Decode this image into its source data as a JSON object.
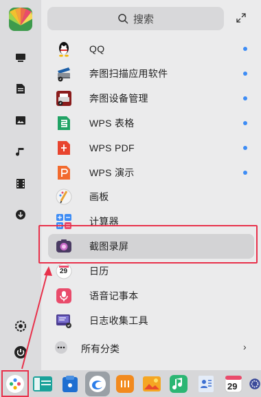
{
  "search": {
    "placeholder": "搜索"
  },
  "apps": [
    {
      "name": "QQ",
      "new": true,
      "icon": "qq-icon"
    },
    {
      "name": "奔图扫描应用软件",
      "new": true,
      "icon": "scanner-icon"
    },
    {
      "name": "奔图设备管理",
      "new": true,
      "icon": "printer-icon"
    },
    {
      "name": "WPS 表格",
      "new": true,
      "icon": "wps-spreadsheet-icon"
    },
    {
      "name": "WPS PDF",
      "new": true,
      "icon": "wps-pdf-icon"
    },
    {
      "name": "WPS 演示",
      "new": true,
      "icon": "wps-presentation-icon"
    },
    {
      "name": "画板",
      "new": false,
      "icon": "paint-icon"
    },
    {
      "name": "计算器",
      "new": false,
      "icon": "calculator-icon"
    },
    {
      "name": "截图录屏",
      "new": false,
      "icon": "screenshot-icon",
      "selected": true
    },
    {
      "name": "日历",
      "new": false,
      "icon": "calendar-icon"
    },
    {
      "name": "语音记事本",
      "new": false,
      "icon": "voice-note-icon"
    },
    {
      "name": "日志收集工具",
      "new": false,
      "icon": "log-collector-icon"
    }
  ],
  "all_categories": {
    "label": "所有分类"
  },
  "calendar_day": "29",
  "dock_calendar": {
    "day": "29"
  },
  "colors": {
    "accent": "#3d8cf5",
    "highlight": "#e8304a"
  }
}
